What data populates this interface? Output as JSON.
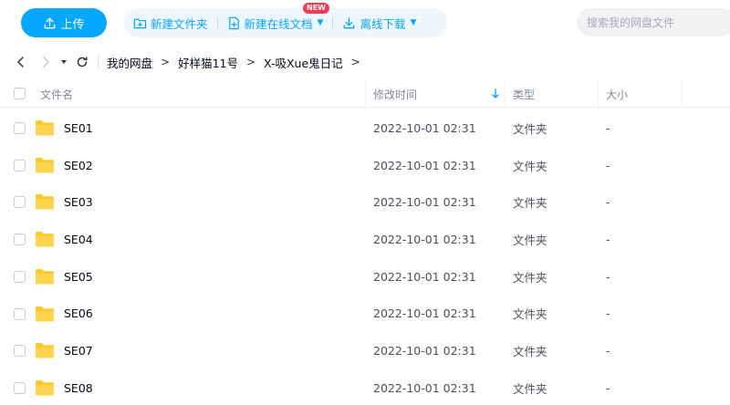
{
  "toolbar": {
    "upload_label": "上传",
    "new_folder_label": "新建文件夹",
    "new_online_doc_label": "新建在线文档",
    "new_badge": "NEW",
    "offline_download_label": "离线下载",
    "search_placeholder": "搜索我的网盘文件"
  },
  "breadcrumb": {
    "items": [
      "我的网盘",
      "好样猫11号",
      "X-吸Xue鬼日记"
    ],
    "separator": ">"
  },
  "table": {
    "columns": {
      "name": "文件名",
      "modified": "修改时间",
      "type": "类型",
      "size": "大小"
    },
    "sort_column": "修改时间",
    "sort_direction": "descending",
    "rows": [
      {
        "name": "SE01",
        "modified": "2022-10-01 02:31",
        "type": "文件夹",
        "size": "-"
      },
      {
        "name": "SE02",
        "modified": "2022-10-01 02:31",
        "type": "文件夹",
        "size": "-"
      },
      {
        "name": "SE03",
        "modified": "2022-10-01 02:31",
        "type": "文件夹",
        "size": "-"
      },
      {
        "name": "SE04",
        "modified": "2022-10-01 02:31",
        "type": "文件夹",
        "size": "-"
      },
      {
        "name": "SE05",
        "modified": "2022-10-01 02:31",
        "type": "文件夹",
        "size": "-"
      },
      {
        "name": "SE06",
        "modified": "2022-10-01 02:31",
        "type": "文件夹",
        "size": "-"
      },
      {
        "name": "SE07",
        "modified": "2022-10-01 02:31",
        "type": "文件夹",
        "size": "-"
      },
      {
        "name": "SE08",
        "modified": "2022-10-01 02:31",
        "type": "文件夹",
        "size": "-"
      }
    ]
  },
  "colors": {
    "accent": "#06a7ff",
    "folder": "#ffca28",
    "badge": "#f43b52",
    "action_group_bg": "#eef6ff"
  },
  "icons": {
    "upload": "upload-icon",
    "new_folder": "folder-plus-icon",
    "new_doc": "document-plus-icon",
    "download": "download-icon",
    "back": "arrow-left-icon",
    "forward": "arrow-right-icon",
    "dropdown": "caret-down-icon",
    "refresh": "refresh-icon",
    "folder": "folder-icon"
  }
}
